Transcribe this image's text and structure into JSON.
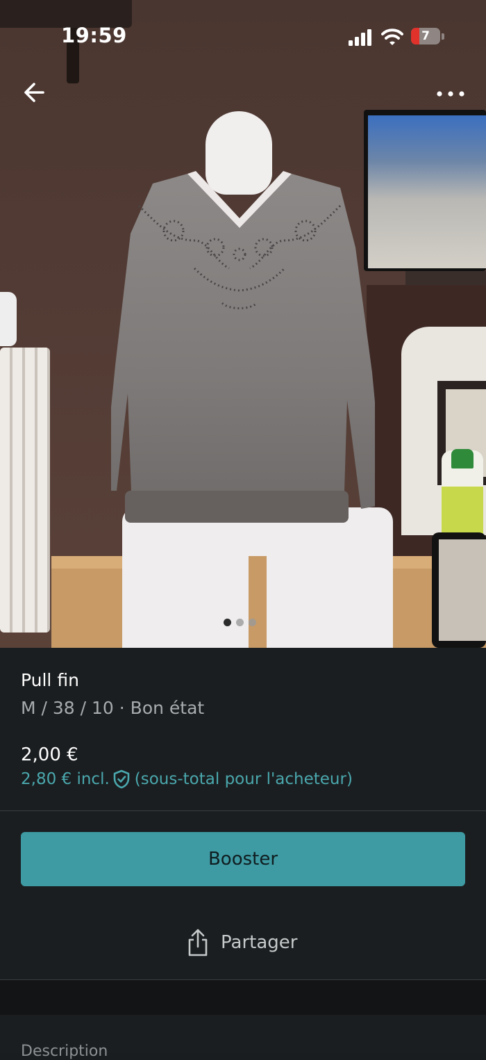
{
  "status_bar": {
    "time": "19:59",
    "battery_level": "7",
    "icons": [
      "signal-icon",
      "wifi-icon",
      "battery-icon"
    ]
  },
  "nav": {
    "back_icon": "arrow-left-icon",
    "more_icon": "more-horizontal-icon"
  },
  "gallery": {
    "image_count": 3,
    "active_index": 0
  },
  "item": {
    "title": "Pull fin",
    "details": "M / 38 / 10 · Bon état",
    "price": "2,00 €",
    "price_incl": "2,80 € incl.",
    "price_incl_note": "(sous-total pour l'acheteur)"
  },
  "actions": {
    "booster_label": "Booster",
    "share_label": "Partager"
  },
  "section": {
    "description_label": "Description"
  },
  "colors": {
    "accent": "#3e9aa3",
    "accent_text": "#4aa8ae",
    "background": "#1b1e20"
  }
}
